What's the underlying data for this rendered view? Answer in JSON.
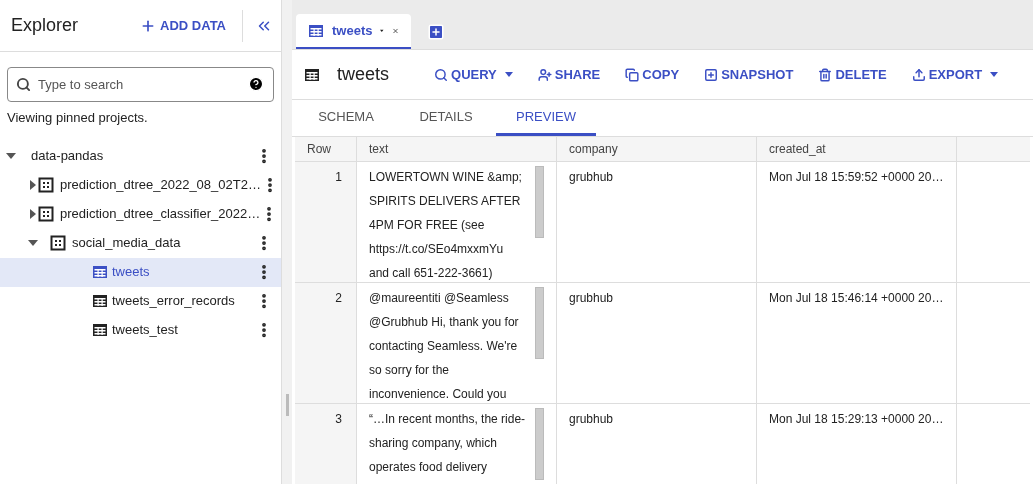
{
  "explorer": {
    "title": "Explorer",
    "add_button": "ADD DATA",
    "search": {
      "placeholder": "Type to search"
    },
    "note": "Viewing pinned projects.",
    "tree": [
      {
        "label": "data-pandas",
        "kind": "project",
        "expanded": true,
        "selected": false,
        "children": [
          {
            "label": "prediction_dtree_2022_08_02T2…",
            "kind": "dataset",
            "expanded": false,
            "selected": false
          },
          {
            "label": "prediction_dtree_classifier_2022…",
            "kind": "dataset",
            "expanded": false,
            "selected": false
          },
          {
            "label": "social_media_data",
            "kind": "dataset",
            "expanded": true,
            "selected": false,
            "children": [
              {
                "label": "tweets",
                "kind": "table",
                "selected": true
              },
              {
                "label": "tweets_error_records",
                "kind": "table",
                "selected": false
              },
              {
                "label": "tweets_test",
                "kind": "table",
                "selected": false
              }
            ]
          }
        ]
      }
    ]
  },
  "tabs": [
    {
      "label": "tweets",
      "selected": true
    }
  ],
  "toolbar": {
    "title": "tweets",
    "actions": [
      {
        "label": "QUERY",
        "kind": "search",
        "dropdown": true
      },
      {
        "label": "SHARE",
        "kind": "share",
        "dropdown": false
      },
      {
        "label": "COPY",
        "kind": "copy",
        "dropdown": false
      },
      {
        "label": "SNAPSHOT",
        "kind": "snapshot",
        "dropdown": false
      },
      {
        "label": "DELETE",
        "kind": "delete",
        "dropdown": false
      },
      {
        "label": "EXPORT",
        "kind": "export",
        "dropdown": true
      }
    ]
  },
  "subtabs": [
    {
      "label": "SCHEMA",
      "selected": false
    },
    {
      "label": "DETAILS",
      "selected": false
    },
    {
      "label": "PREVIEW",
      "selected": true
    }
  ],
  "table": {
    "columns": [
      "Row",
      "text",
      "company",
      "created_at"
    ],
    "rows": [
      {
        "row": "1",
        "text": [
          "LOWERTOWN WINE &amp;",
          "SPIRITS DELIVERS AFTER",
          "4PM FOR FREE (see",
          "https://t.co/SEo4mxxmYu",
          "and call 651-222-3661)"
        ],
        "company": "grubhub",
        "created_at": "Mon Jul 18 15:59:52 +0000 20…"
      },
      {
        "row": "2",
        "text": [
          "@maureentiti @Seamless",
          "@Grubhub Hi, thank you for",
          "contacting Seamless. We're",
          "so sorry for the",
          "inconvenience. Could you"
        ],
        "company": "grubhub",
        "created_at": "Mon Jul 18 15:46:14 +0000 20…"
      },
      {
        "row": "3",
        "text": [
          "“…In recent months, the ride-",
          "sharing company, which",
          "operates food delivery"
        ],
        "company": "grubhub",
        "created_at": "Mon Jul 18 15:29:13 +0000 20…"
      }
    ]
  }
}
